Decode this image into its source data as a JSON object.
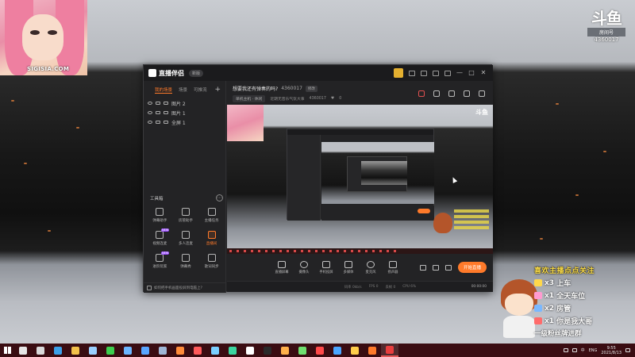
{
  "colors": {
    "accent": "#ff7a2a",
    "taskbar": "#3a0d12",
    "window_bg": "#232325"
  },
  "webcam": {
    "watermark": "SIGISIA.COM"
  },
  "brand": {
    "logo_text": "斗鱼",
    "room_label": "房间号",
    "room_id": "4360017"
  },
  "app": {
    "name": "直播伴侣",
    "version_label": "新版",
    "titlebar_icons": [
      "avatar-icon",
      "message-icon",
      "screen-icon",
      "shirt-icon",
      "settings-icon"
    ],
    "window_buttons": [
      "—",
      "□",
      "✕"
    ],
    "scene_tabs": [
      "我的场景",
      "场景",
      "可推流"
    ],
    "layers": [
      {
        "label": "图片 2",
        "icon": "image-icon"
      },
      {
        "label": "图片 1",
        "icon": "image-icon"
      },
      {
        "label": "全屏 1",
        "icon": "monitor-icon"
      }
    ],
    "toolbox_title": "工具箱",
    "tools": [
      {
        "label": "弹幕助手",
        "icon": "danmu-icon",
        "hot": false
      },
      {
        "label": "房管助手",
        "icon": "user-admin-icon",
        "hot": false
      },
      {
        "label": "主播任务",
        "icon": "task-icon",
        "hot": false
      },
      {
        "label": "视频连麦",
        "icon": "video-call-icon",
        "hot": false,
        "badge": "NEW"
      },
      {
        "label": "多人连麦",
        "icon": "multi-call-icon",
        "hot": false
      },
      {
        "label": "直播间",
        "icon": "live-room-icon",
        "hot": true
      },
      {
        "label": "进阶玩家",
        "icon": "player-icon",
        "hot": false,
        "badge": "NEW"
      },
      {
        "label": "弹幕秀",
        "icon": "danmu-show-icon",
        "hot": false
      },
      {
        "label": "歌词同步",
        "icon": "lyrics-icon",
        "hot": false
      }
    ],
    "sidebar_footer": "如何把手机画面投屏到电脑上?",
    "room_title": "想要我还有弹奏的吗?",
    "room_id": "4360017",
    "edit_label": "修改",
    "category": "单机主机 · 休闲",
    "announcement": "近期无音乐气氛大事",
    "announcement_id": "4360017",
    "like_count": "0",
    "header_icons": [
      "gift-icon",
      "lock-icon",
      "shirt-icon",
      "bell-icon",
      "share-icon"
    ],
    "controls": [
      {
        "label": "直播屏幕",
        "icon": "screen-share-icon"
      },
      {
        "label": "摄像头",
        "icon": "camera-icon"
      },
      {
        "label": "手机投屏",
        "icon": "phone-cast-icon"
      },
      {
        "label": "多媒体",
        "icon": "media-icon"
      },
      {
        "label": "麦克风",
        "icon": "mic-icon"
      },
      {
        "label": "扬声器",
        "icon": "speaker-icon"
      }
    ],
    "live_button": "开始直播",
    "status": {
      "bitrate": "码率 0kb/s",
      "fps": "FPS 0",
      "dropped": "丢帧 0",
      "cpu": "CPU 6%",
      "time": "00:00:00"
    }
  },
  "overlay": {
    "title": "喜欢主播点点关注",
    "lines": [
      {
        "count": "x3",
        "text": "上车",
        "icon": "yacht-gift-icon"
      },
      {
        "count": "x1",
        "text": "全天车位",
        "icon": "car-gift-icon"
      },
      {
        "count": "x2",
        "text": "房管",
        "icon": "crown-gift-icon"
      },
      {
        "count": "x1",
        "text": "你是我大哥",
        "icon": "rocket-gift-icon"
      }
    ],
    "footer": "一级粉丝牌进群"
  },
  "taskbar": {
    "apps": [
      {
        "name": "search-icon",
        "color": "#e6e6e6"
      },
      {
        "name": "taskview-icon",
        "color": "#d9d9d9"
      },
      {
        "name": "edge-icon",
        "color": "#3aa0e8"
      },
      {
        "name": "explorer-icon",
        "color": "#f2c14a"
      },
      {
        "name": "store-icon",
        "color": "#9ad0ff"
      },
      {
        "name": "wechat-icon",
        "color": "#3ccf4e"
      },
      {
        "name": "photos-icon",
        "color": "#6bb6ff"
      },
      {
        "name": "qq-icon",
        "color": "#59a6ff"
      },
      {
        "name": "steam-icon",
        "color": "#9fb7d6"
      },
      {
        "name": "firefox-icon",
        "color": "#ff8c3a"
      },
      {
        "name": "media-player-icon",
        "color": "#ff5a5a"
      },
      {
        "name": "bird-icon",
        "color": "#7acfff"
      },
      {
        "name": "edge-dev-icon",
        "color": "#3bd6a0"
      },
      {
        "name": "music-icon",
        "color": "#ffffff"
      },
      {
        "name": "obs-icon",
        "color": "#2a2a2a"
      },
      {
        "name": "game-icon",
        "color": "#ffb04a"
      },
      {
        "name": "tool-icon",
        "color": "#6fe06f"
      },
      {
        "name": "pdf-icon",
        "color": "#ff4a4a"
      },
      {
        "name": "mail-icon",
        "color": "#4aa6ff"
      },
      {
        "name": "paint-icon",
        "color": "#ffcd4a"
      },
      {
        "name": "douyu-icon",
        "color": "#ff7a2a"
      },
      {
        "name": "live-companion-icon",
        "color": "#e83e3e"
      }
    ],
    "ime": "中",
    "lang": "ENG",
    "time": "9:55",
    "date": "2021/8/13"
  }
}
